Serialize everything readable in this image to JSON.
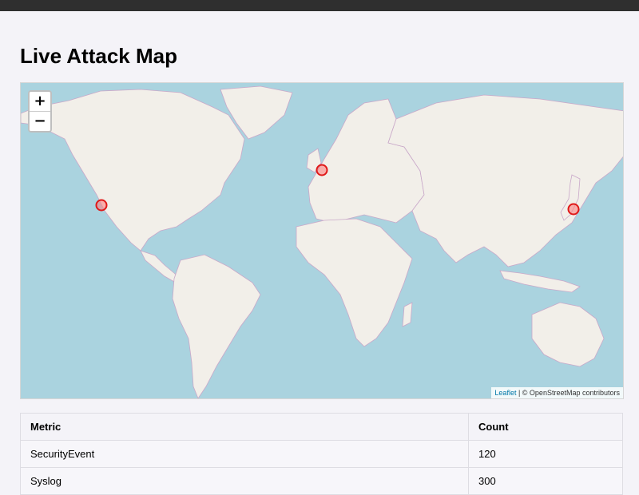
{
  "page": {
    "title": "Live Attack Map"
  },
  "colors": {
    "topbar": "#2f2f2f",
    "background": "#f4f3f8",
    "ocean": "#aad3df",
    "land": "#f2efe9",
    "border": "#c8a0c8",
    "marker_stroke": "#e01818",
    "marker_fill": "#ff7878"
  },
  "map": {
    "zoom_in_label": "+",
    "zoom_out_label": "−",
    "attribution_link": "Leaflet",
    "attribution_separator": " | ",
    "attribution_text": "© OpenStreetMap contributors",
    "markers": [
      {
        "name": "marker-california",
        "lat": 34.0,
        "lon": -118.2
      },
      {
        "name": "marker-europe",
        "lat": 50.5,
        "lon": 2.5
      },
      {
        "name": "marker-japan",
        "lat": 35.7,
        "lon": 139.7
      }
    ]
  },
  "table": {
    "headers": [
      "Metric",
      "Count"
    ],
    "rows": [
      [
        "SecurityEvent",
        "120"
      ],
      [
        "Syslog",
        "300"
      ]
    ]
  }
}
